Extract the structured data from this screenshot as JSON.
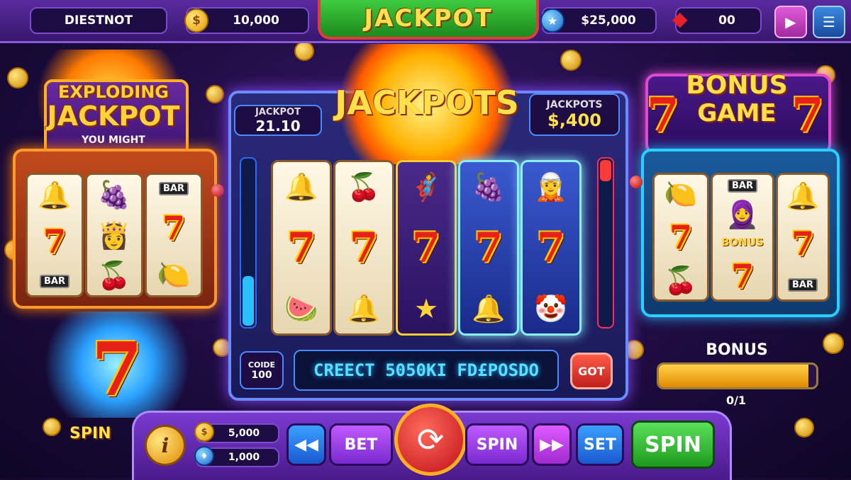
{
  "topbar": {
    "player_name": "DIESTNOT",
    "coins": "10,000",
    "coin_symbol": "$",
    "jackpot_title": "JACKPOT",
    "prize": "$25,000",
    "gems": "00"
  },
  "left": {
    "title_line1": "EXPLODING",
    "title_line2": "JACKPOT",
    "subtitle": "YOU MIGHT",
    "reels": [
      [
        "bell-icon",
        "7",
        "BAR"
      ],
      [
        "grapes-icon",
        "character-icon",
        "cherries-icon"
      ],
      [
        "BAR",
        "7",
        "lemon-icon"
      ]
    ],
    "big_seven": "7",
    "spin_label": "SPIN"
  },
  "center": {
    "burst_title": "JACKPOTS",
    "left_meter_label": "JACKPOT",
    "left_meter_value": "21.10",
    "right_meter_label": "JACKPOTS",
    "right_meter_value": "$,400",
    "code_label": "COIDE",
    "code_value": "100",
    "marquee": "CREECT 5050KI FD£POSDO",
    "got_button": "GOT",
    "seven": "7"
  },
  "right": {
    "title_line1": "BONUS",
    "title_line2": "GAME",
    "seven": "7",
    "bonus_reel_label": "BONUS",
    "bar_label": "BAR",
    "bonus_label": "BONUS",
    "bonus_progress_text": "0/1",
    "bonus_progress": 0.95
  },
  "bottom": {
    "info": "i",
    "bet_amount": "5,000",
    "lines_amount": "1,000",
    "bet_button": "BET",
    "spin_small_button": "SPIN",
    "set_button": "SET",
    "spin_button": "SPIN"
  },
  "colors": {
    "accent_purple": "#7a3ad0",
    "spin_green": "#2ab82a",
    "jackpot_gold": "#ffd23a"
  }
}
